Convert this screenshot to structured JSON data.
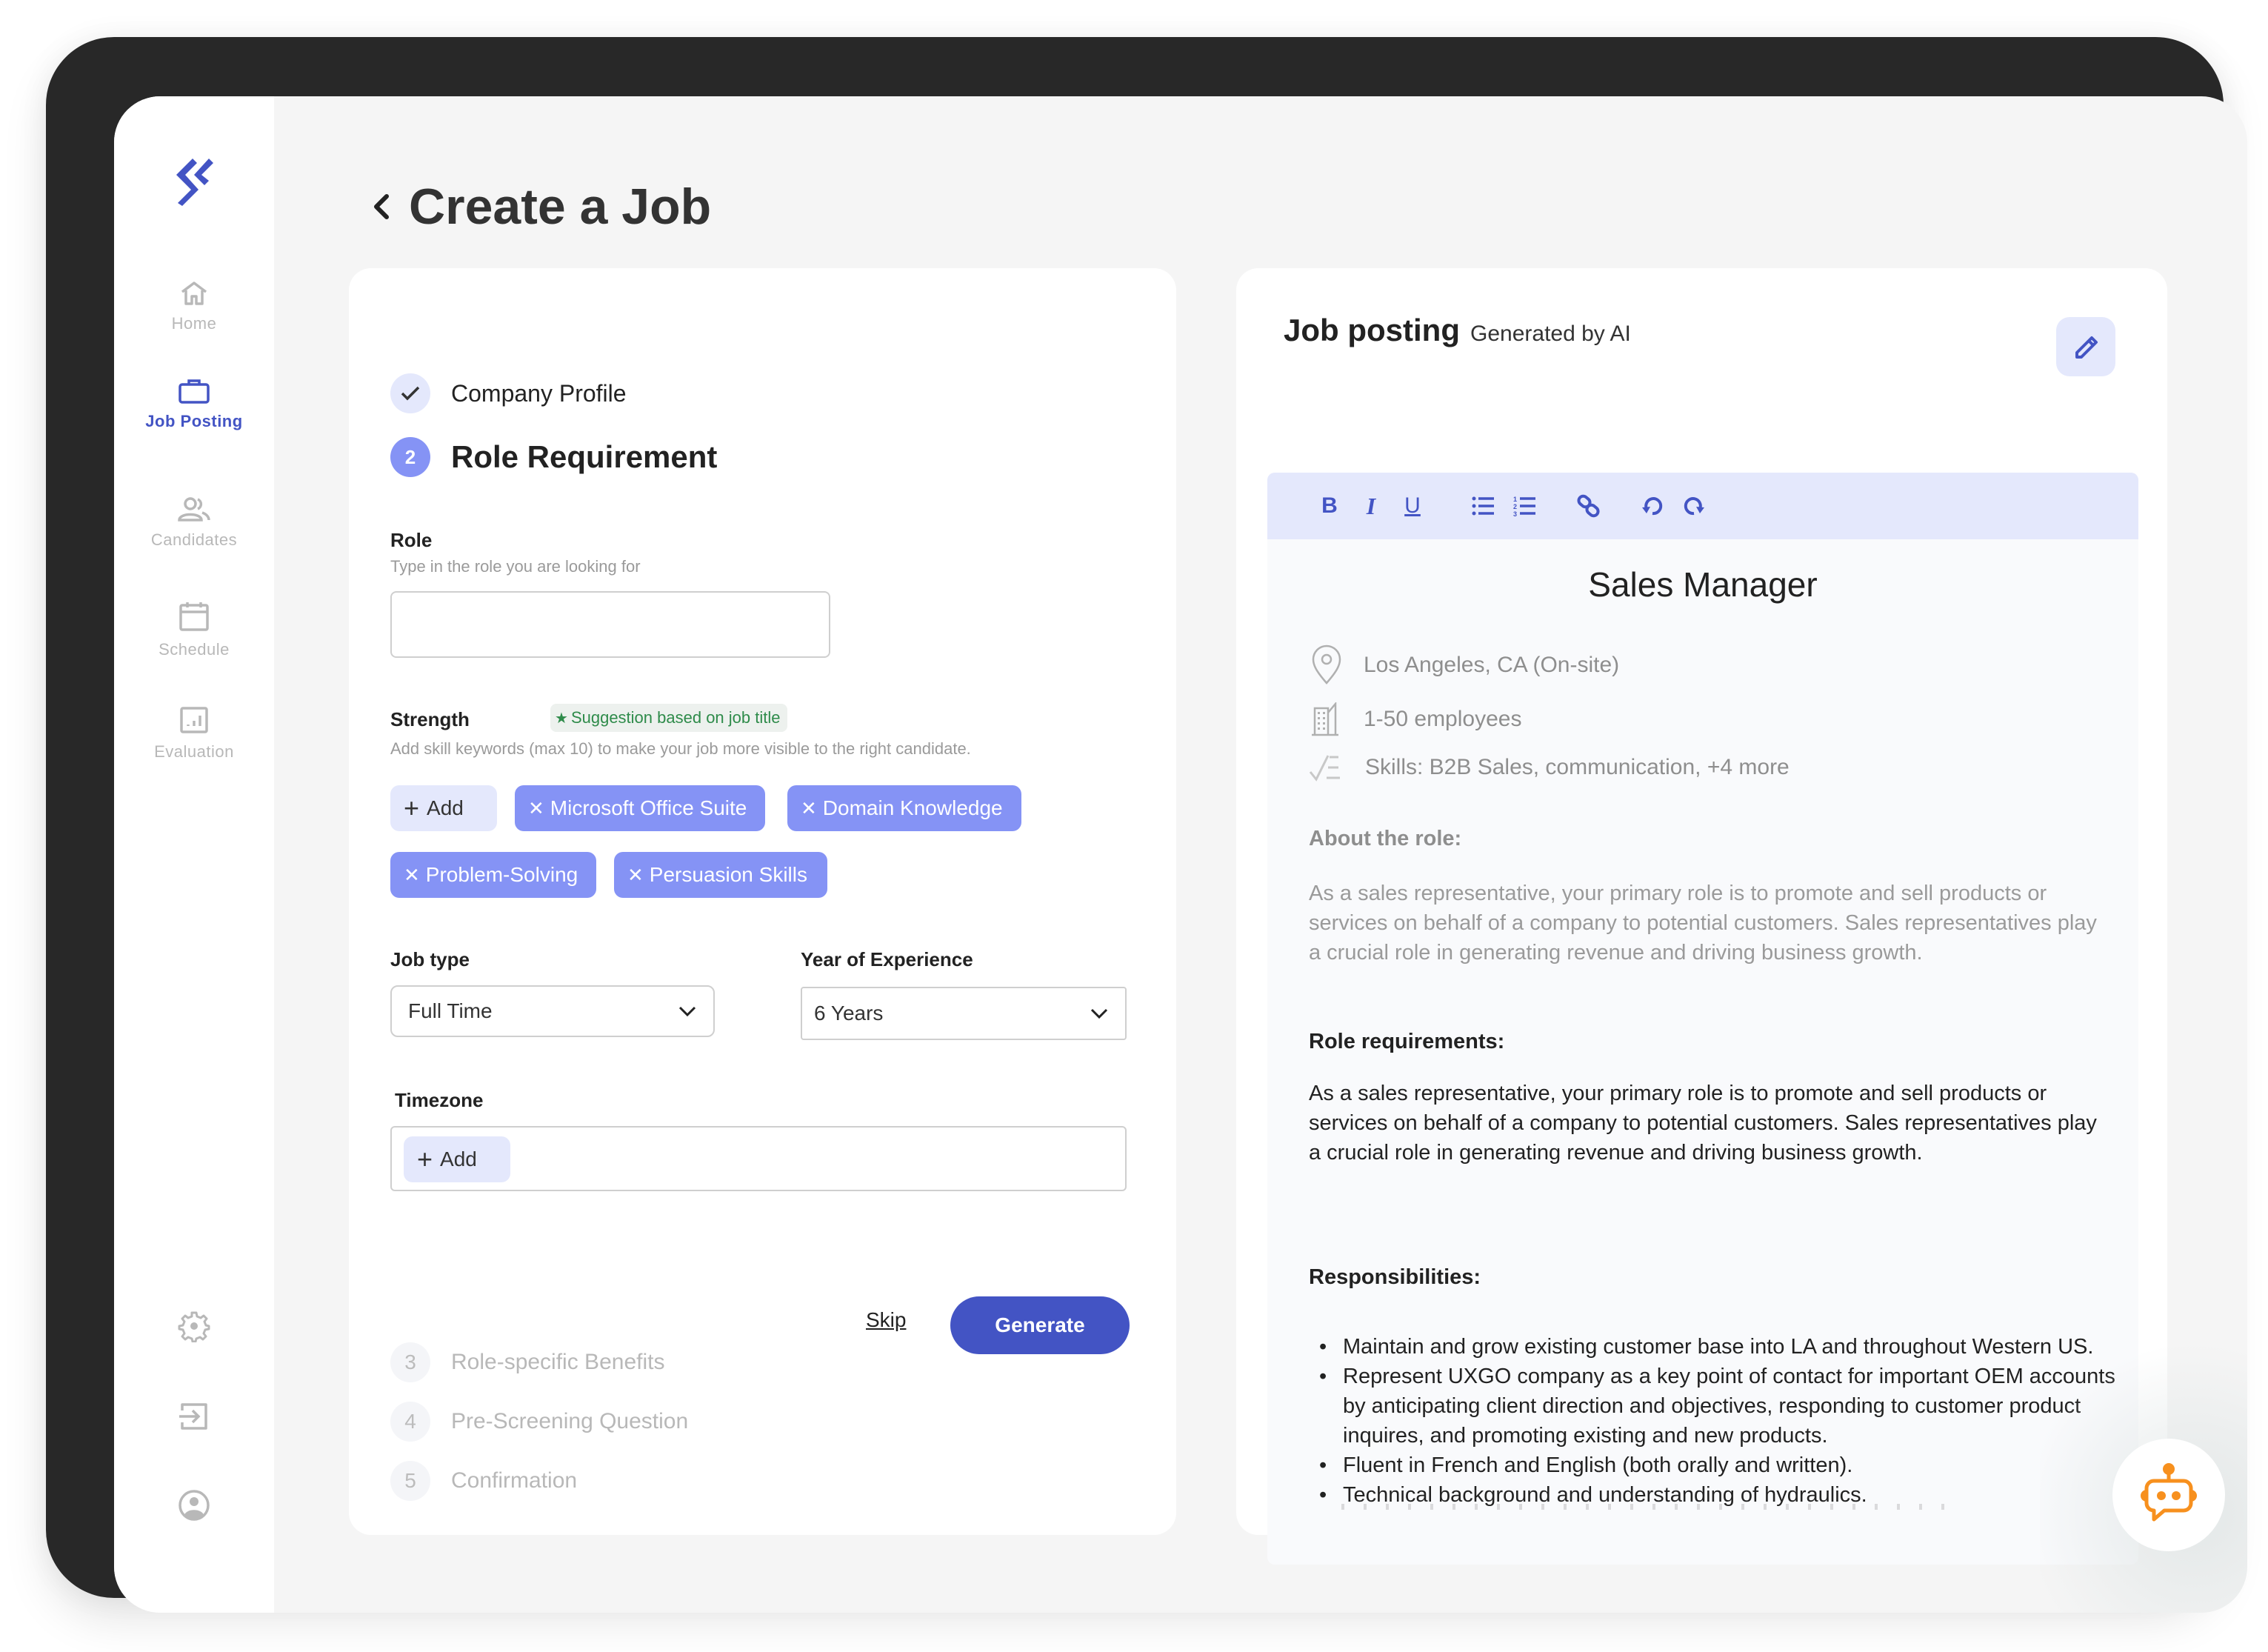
{
  "sidebar": {
    "items": [
      {
        "label": "Home",
        "icon": "home-icon",
        "active": false
      },
      {
        "label": "Job Posting",
        "icon": "briefcase-icon",
        "active": true
      },
      {
        "label": "Candidates",
        "icon": "users-icon",
        "active": false
      },
      {
        "label": "Schedule",
        "icon": "calendar-icon",
        "active": false
      },
      {
        "label": "Evaluation",
        "icon": "chart-icon",
        "active": false
      }
    ],
    "bottom_icons": [
      "gear-icon",
      "logout-icon",
      "user-circle-icon"
    ]
  },
  "header": {
    "title": "Create a Job"
  },
  "steps": [
    {
      "number": "✓",
      "label": "Company Profile",
      "state": "done"
    },
    {
      "number": "2",
      "label": "Role Requirement",
      "state": "current"
    },
    {
      "number": "3",
      "label": "Role-specific Benefits",
      "state": "future"
    },
    {
      "number": "4",
      "label": "Pre-Screening Question",
      "state": "future"
    },
    {
      "number": "5",
      "label": "Confirmation",
      "state": "future"
    }
  ],
  "form": {
    "role": {
      "label": "Role",
      "hint": "Type in the role you are looking for",
      "value": "",
      "placeholder": ""
    },
    "strength": {
      "label": "Strength",
      "badge": "Suggestion based on job title",
      "hint": "Add skill keywords (max 10) to make your job more visible to the right candidate.",
      "add_label": "Add",
      "skills": [
        "Microsoft Office Suite",
        "Domain Knowledge",
        "Problem-Solving",
        "Persuasion Skills"
      ]
    },
    "job_type": {
      "label": "Job type",
      "value": "Full Time"
    },
    "experience": {
      "label": "Year of Experience",
      "value": "6 Years"
    },
    "timezone": {
      "label": "Timezone",
      "add_label": "Add"
    },
    "skip_label": "Skip",
    "generate_label": "Generate"
  },
  "job_posting": {
    "title": "Job posting",
    "subtitle": "Generated by AI",
    "toolbar": [
      "bold",
      "italic",
      "underline",
      "bullet-list",
      "numbered-list",
      "link",
      "undo",
      "redo"
    ],
    "doc": {
      "job_title": "Sales Manager",
      "location": "Los Angeles, CA (On-site)",
      "company_size": "1-50 employees",
      "skills": "Skills: B2B Sales, communication, +4 more",
      "about_heading": "About the role:",
      "about_text": "As a sales representative, your primary role is to promote and sell products or services on behalf of a company to potential customers. Sales representatives play a crucial role in generating revenue and driving business growth.",
      "requirements_heading": "Role requirements:",
      "requirements_text": "As a sales representative, your primary role is to promote and sell products or services on behalf of a company to potential customers. Sales representatives play a crucial role in generating revenue and driving business growth.",
      "responsibilities_heading": "Responsibilities:",
      "responsibilities": [
        "Maintain and grow existing customer base into LA and throughout Western US.",
        "Represent UXGO company as a key point of contact for important OEM accounts by anticipating client direction and objectives, responding to customer product inquires, and promoting existing and new products.",
        "Fluent in French and English (both orally and written).",
        "Technical background and understanding of hydraulics."
      ]
    }
  },
  "colors": {
    "accent": "#4354c4",
    "chip": "#8593f5",
    "chip_light": "#e4e8fc",
    "bot": "#f7901e",
    "suggest_green": "#2e8b4a"
  }
}
